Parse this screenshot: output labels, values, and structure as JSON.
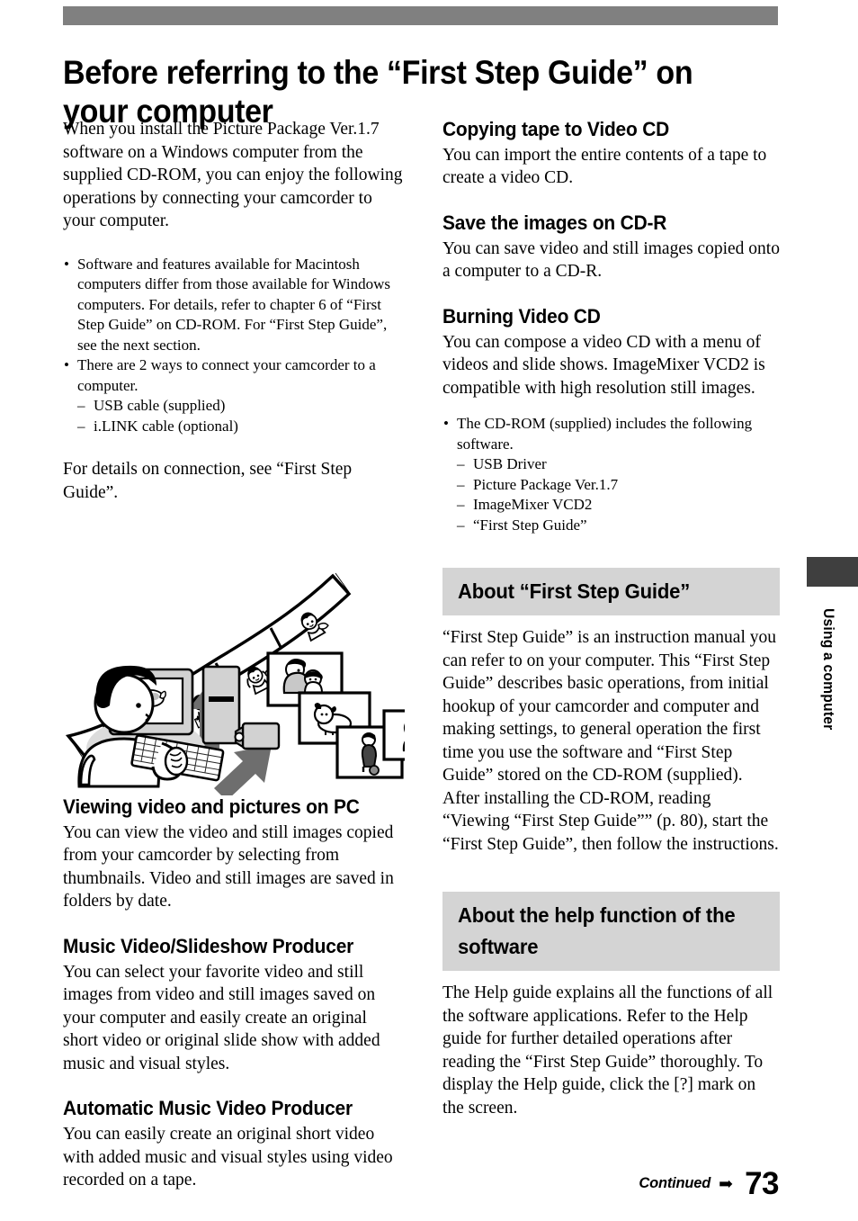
{
  "header": {
    "rule_color": "#808080",
    "title": "Before referring to the “First Step Guide” on your computer"
  },
  "edge_tab": {
    "label": "Using a computer",
    "color": "#3f3f3f"
  },
  "left_column": {
    "intro": "When you install the Picture Package Ver.1.7 software on a Windows computer from the supplied CD-ROM, you can enjoy the following operations by connecting your camcorder to your computer.",
    "notes": [
      "Software and features available for Macintosh computers differ from those available for Windows computers. For details, refer to chapter 6 of “First Step Guide” on CD-ROM. For “First Step Guide”, see the next section.",
      "There are 2 ways to connect your camcorder to a computer."
    ],
    "cable_options": [
      "USB cable (supplied)",
      "i.LINK cable (optional)"
    ],
    "connection_note": "For details on connection, see “First Step Guide”.",
    "illustration_alt": "Person at a computer with filmstrip, photo thumbnails and CDs",
    "sections": [
      {
        "heading": "Viewing video and pictures on PC",
        "body": "You can view the video and still images copied from your camcorder by selecting from thumbnails. Video and still images are saved in folders by date."
      },
      {
        "heading": "Music Video/Slideshow Producer",
        "body": "You can select your favorite video and still images from video and still images saved on your computer and easily create an original short video or original slide show with added music and visual styles."
      },
      {
        "heading": "Automatic Music Video Producer",
        "body": "You can easily create an original short video with added music and visual styles using video recorded on a tape."
      }
    ]
  },
  "right_column": {
    "sections": [
      {
        "heading": "Copying tape to Video CD",
        "body": "You can import the entire contents of a tape to create a video CD."
      },
      {
        "heading": "Save the images on CD-R",
        "body": "You can save video and still images copied onto a computer to a CD-R."
      },
      {
        "heading": "Burning Video CD",
        "body": "You can compose a video CD with a menu of videos and slide shows. ImageMixer VCD2 is compatible with high resolution still images."
      }
    ],
    "cdrom_note": "The CD-ROM (supplied) includes the following software.",
    "cdrom_contents": [
      "USB Driver",
      "Picture Package Ver.1.7",
      "ImageMixer VCD2",
      "“First Step Guide”"
    ],
    "boxed_sections": [
      {
        "heading": "About “First Step Guide”",
        "body": "“First Step Guide” is an instruction manual you can refer to on your computer. This “First Step Guide” describes basic operations, from initial hookup of your camcorder and computer and making settings, to general operation the first time you use the software and “First Step Guide” stored on the CD-ROM (supplied). After installing the CD-ROM, reading “Viewing “First Step Guide”” (p. 80), start the “First Step Guide”, then follow the instructions."
      },
      {
        "heading": "About the help function of the software",
        "body": "The Help guide explains all the functions of all the software applications. Refer to the Help guide for further detailed operations after reading the “First Step Guide” thoroughly. To display the Help guide, click the [?] mark on the screen."
      }
    ],
    "section_head_color": "#d4d4d4"
  },
  "footer": {
    "continued_label": "Continued",
    "arrow": "➡",
    "page_number": "73"
  }
}
